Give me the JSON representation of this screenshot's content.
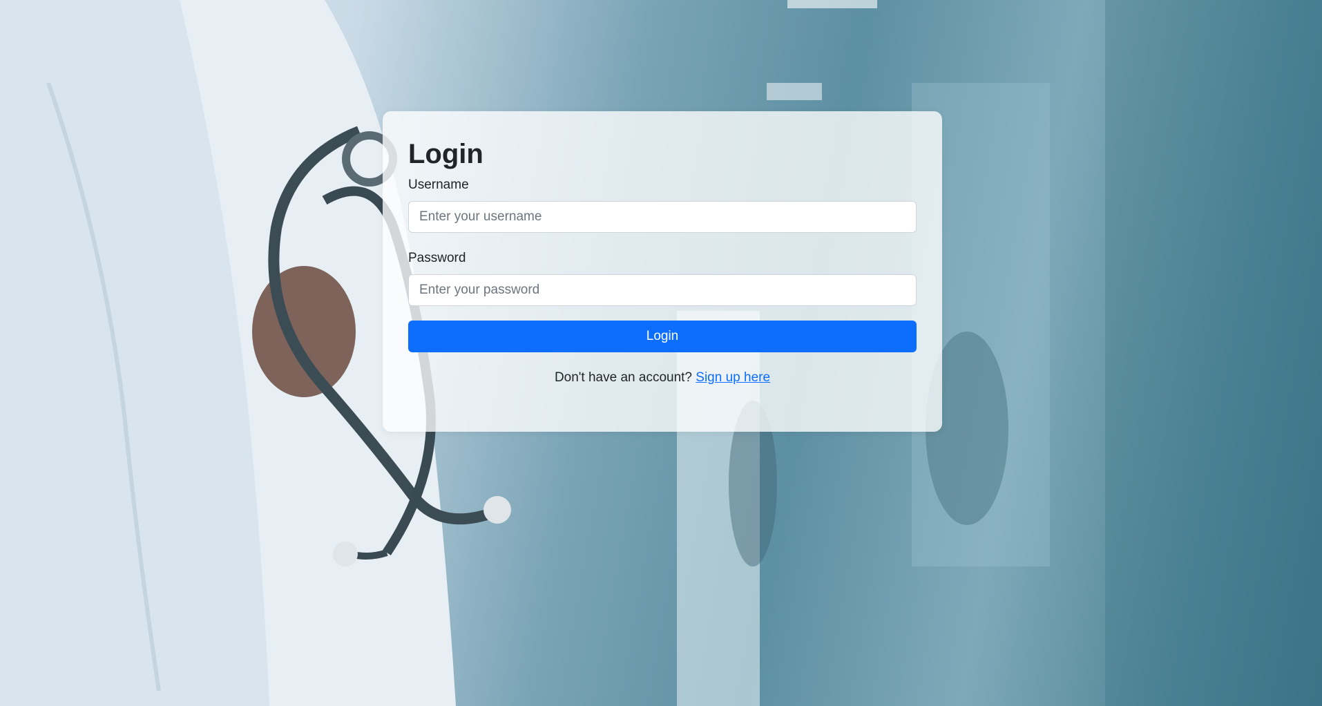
{
  "login": {
    "title": "Login",
    "username_label": "Username",
    "username_placeholder": "Enter your username",
    "username_value": "",
    "password_label": "Password",
    "password_placeholder": "Enter your password",
    "password_value": "",
    "submit_label": "Login",
    "signup_prompt": "Don't have an account?",
    "signup_link": "Sign up here"
  },
  "colors": {
    "primary": "#0d6efd",
    "text": "#212529",
    "placeholder": "#6c757d"
  }
}
